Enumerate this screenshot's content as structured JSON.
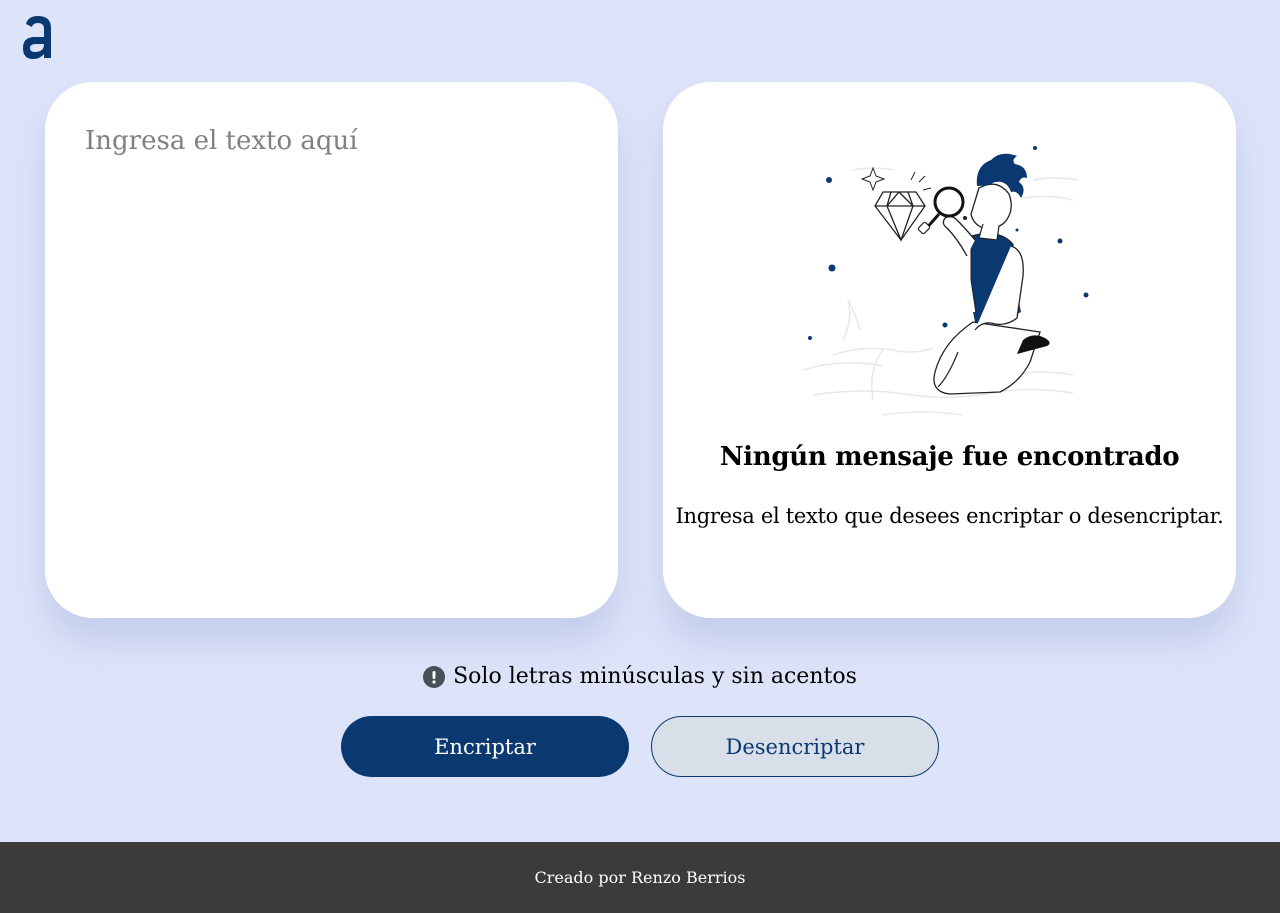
{
  "app": {
    "logo_icon": "alura-logo-icon"
  },
  "input_panel": {
    "placeholder": "Ingresa el texto aquí",
    "value": ""
  },
  "output_panel": {
    "illustration_icon": "person-magnifying-glass-illustration",
    "title": "Ningún mensaje fue encontrado",
    "description": "Ingresa el texto que desees encriptar o desencriptar."
  },
  "hint": {
    "icon": "exclamation-circle-icon",
    "text": "Solo letras minúsculas y sin acentos"
  },
  "actions": {
    "encrypt_label": "Encriptar",
    "decrypt_label": "Desencriptar"
  },
  "footer": {
    "text": "Creado por Renzo Berrios"
  },
  "colors": {
    "background": "#dde3f9",
    "primary": "#0a3871",
    "secondary_button_bg": "#d8dfe8",
    "footer_bg": "#3d3b3a"
  }
}
